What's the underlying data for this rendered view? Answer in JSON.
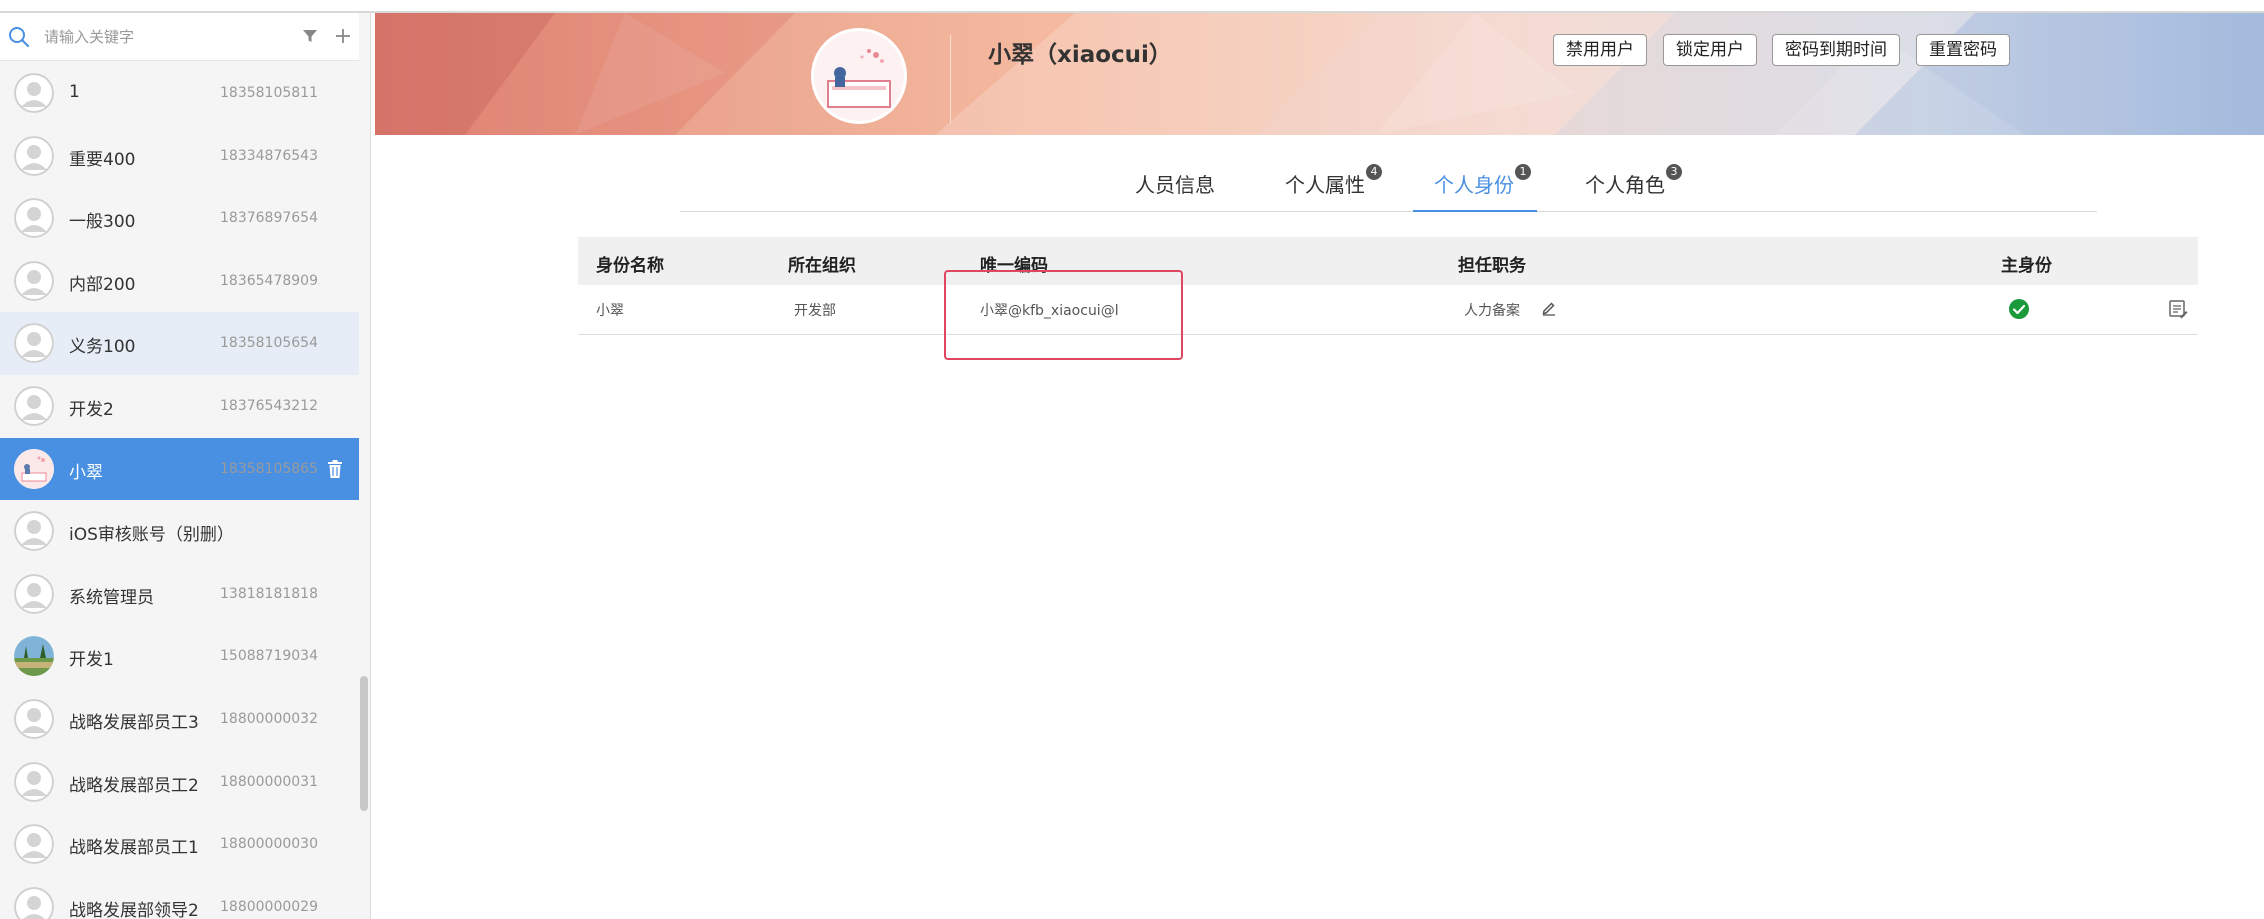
{
  "sidebar": {
    "search_placeholder": "请输入关键字",
    "users": [
      {
        "name": "1",
        "phone": "18358105811"
      },
      {
        "name": "重要400",
        "phone": "18334876543"
      },
      {
        "name": "一般300",
        "phone": "18376897654"
      },
      {
        "name": "内部200",
        "phone": "18365478909"
      },
      {
        "name": "义务100",
        "phone": "18358105654"
      },
      {
        "name": "开发2",
        "phone": "18376543212"
      },
      {
        "name": "小翠",
        "phone": "18358105865"
      },
      {
        "name": "iOS审核账号（别删）",
        "phone": ""
      },
      {
        "name": "系统管理员",
        "phone": "13818181818"
      },
      {
        "name": "开发1",
        "phone": "15088719034"
      },
      {
        "name": "战略发展部员工3",
        "phone": "18800000032"
      },
      {
        "name": "战略发展部员工2",
        "phone": "18800000031"
      },
      {
        "name": "战略发展部员工1",
        "phone": "18800000030"
      },
      {
        "name": "战略发展部领导2",
        "phone": "18800000029"
      }
    ]
  },
  "header": {
    "name": "小翠（xiaocui）",
    "buttons": {
      "disable": "禁用用户",
      "lock": "锁定用户",
      "password_expiry": "密码到期时间",
      "reset_password": "重置密码"
    }
  },
  "tabs": [
    {
      "label": "人员信息",
      "badge": ""
    },
    {
      "label": "个人属性",
      "badge": "4"
    },
    {
      "label": "个人身份",
      "badge": "1"
    },
    {
      "label": "个人角色",
      "badge": "3"
    }
  ],
  "table": {
    "headers": {
      "identity_name": "身份名称",
      "organization": "所在组织",
      "unique_code": "唯一编码",
      "position": "担任职务",
      "primary": "主身份"
    },
    "rows": [
      {
        "identity_name": "小翠",
        "organization": "开发部",
        "unique_code": "小翠@kfb_xiaocui@l",
        "position": "人力备案"
      }
    ]
  },
  "colors": {
    "accent": "#4a90e2",
    "highlight": "#e0465f",
    "success": "#1a9a3a"
  }
}
